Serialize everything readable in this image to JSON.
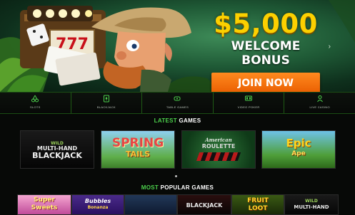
{
  "hero": {
    "amount": "$5,000",
    "subtitle": "WELCOME BONUS",
    "cta": "JOIN NOW",
    "next_arrow": "›",
    "slot_reel": "777"
  },
  "nav": [
    {
      "label": "SLOTS",
      "icon": "cherry-icon"
    },
    {
      "label": "BLACKJACK",
      "icon": "spade-card-icon"
    },
    {
      "label": "TABLE GAMES",
      "icon": "table-icon"
    },
    {
      "label": "VIDEO POKER",
      "icon": "video-poker-icon"
    },
    {
      "label": "LIVE CASINO",
      "icon": "live-dealer-icon"
    }
  ],
  "latest": {
    "title_accent": "LATEST",
    "title_rest": " GAMES",
    "games": [
      {
        "line1": "WILD",
        "line2": "MULTI-HAND",
        "line3": "BLACKJACK"
      },
      {
        "line1": "SPRING",
        "line2": "TAILS"
      },
      {
        "line1": "American",
        "line2": "ROULETTE"
      },
      {
        "line1": "Epic",
        "line2": "Ape"
      }
    ]
  },
  "popular": {
    "title_accent": "MOST",
    "title_rest": " POPULAR GAMES",
    "games": [
      {
        "line1": "Super",
        "line2": "Sweets"
      },
      {
        "line1": "Bubbles",
        "line2": "Bonanza"
      },
      {
        "line1": ""
      },
      {
        "line1": "BLACKJACK"
      },
      {
        "line1": "FRUIT",
        "line2": "LOOT"
      },
      {
        "line1": "WILD",
        "line2": "MULTI-HAND"
      }
    ]
  },
  "colors": {
    "gold": "#fcd000",
    "orange": "#f07000",
    "green_accent": "#4cd04c",
    "nav_border": "#1b4d14"
  }
}
